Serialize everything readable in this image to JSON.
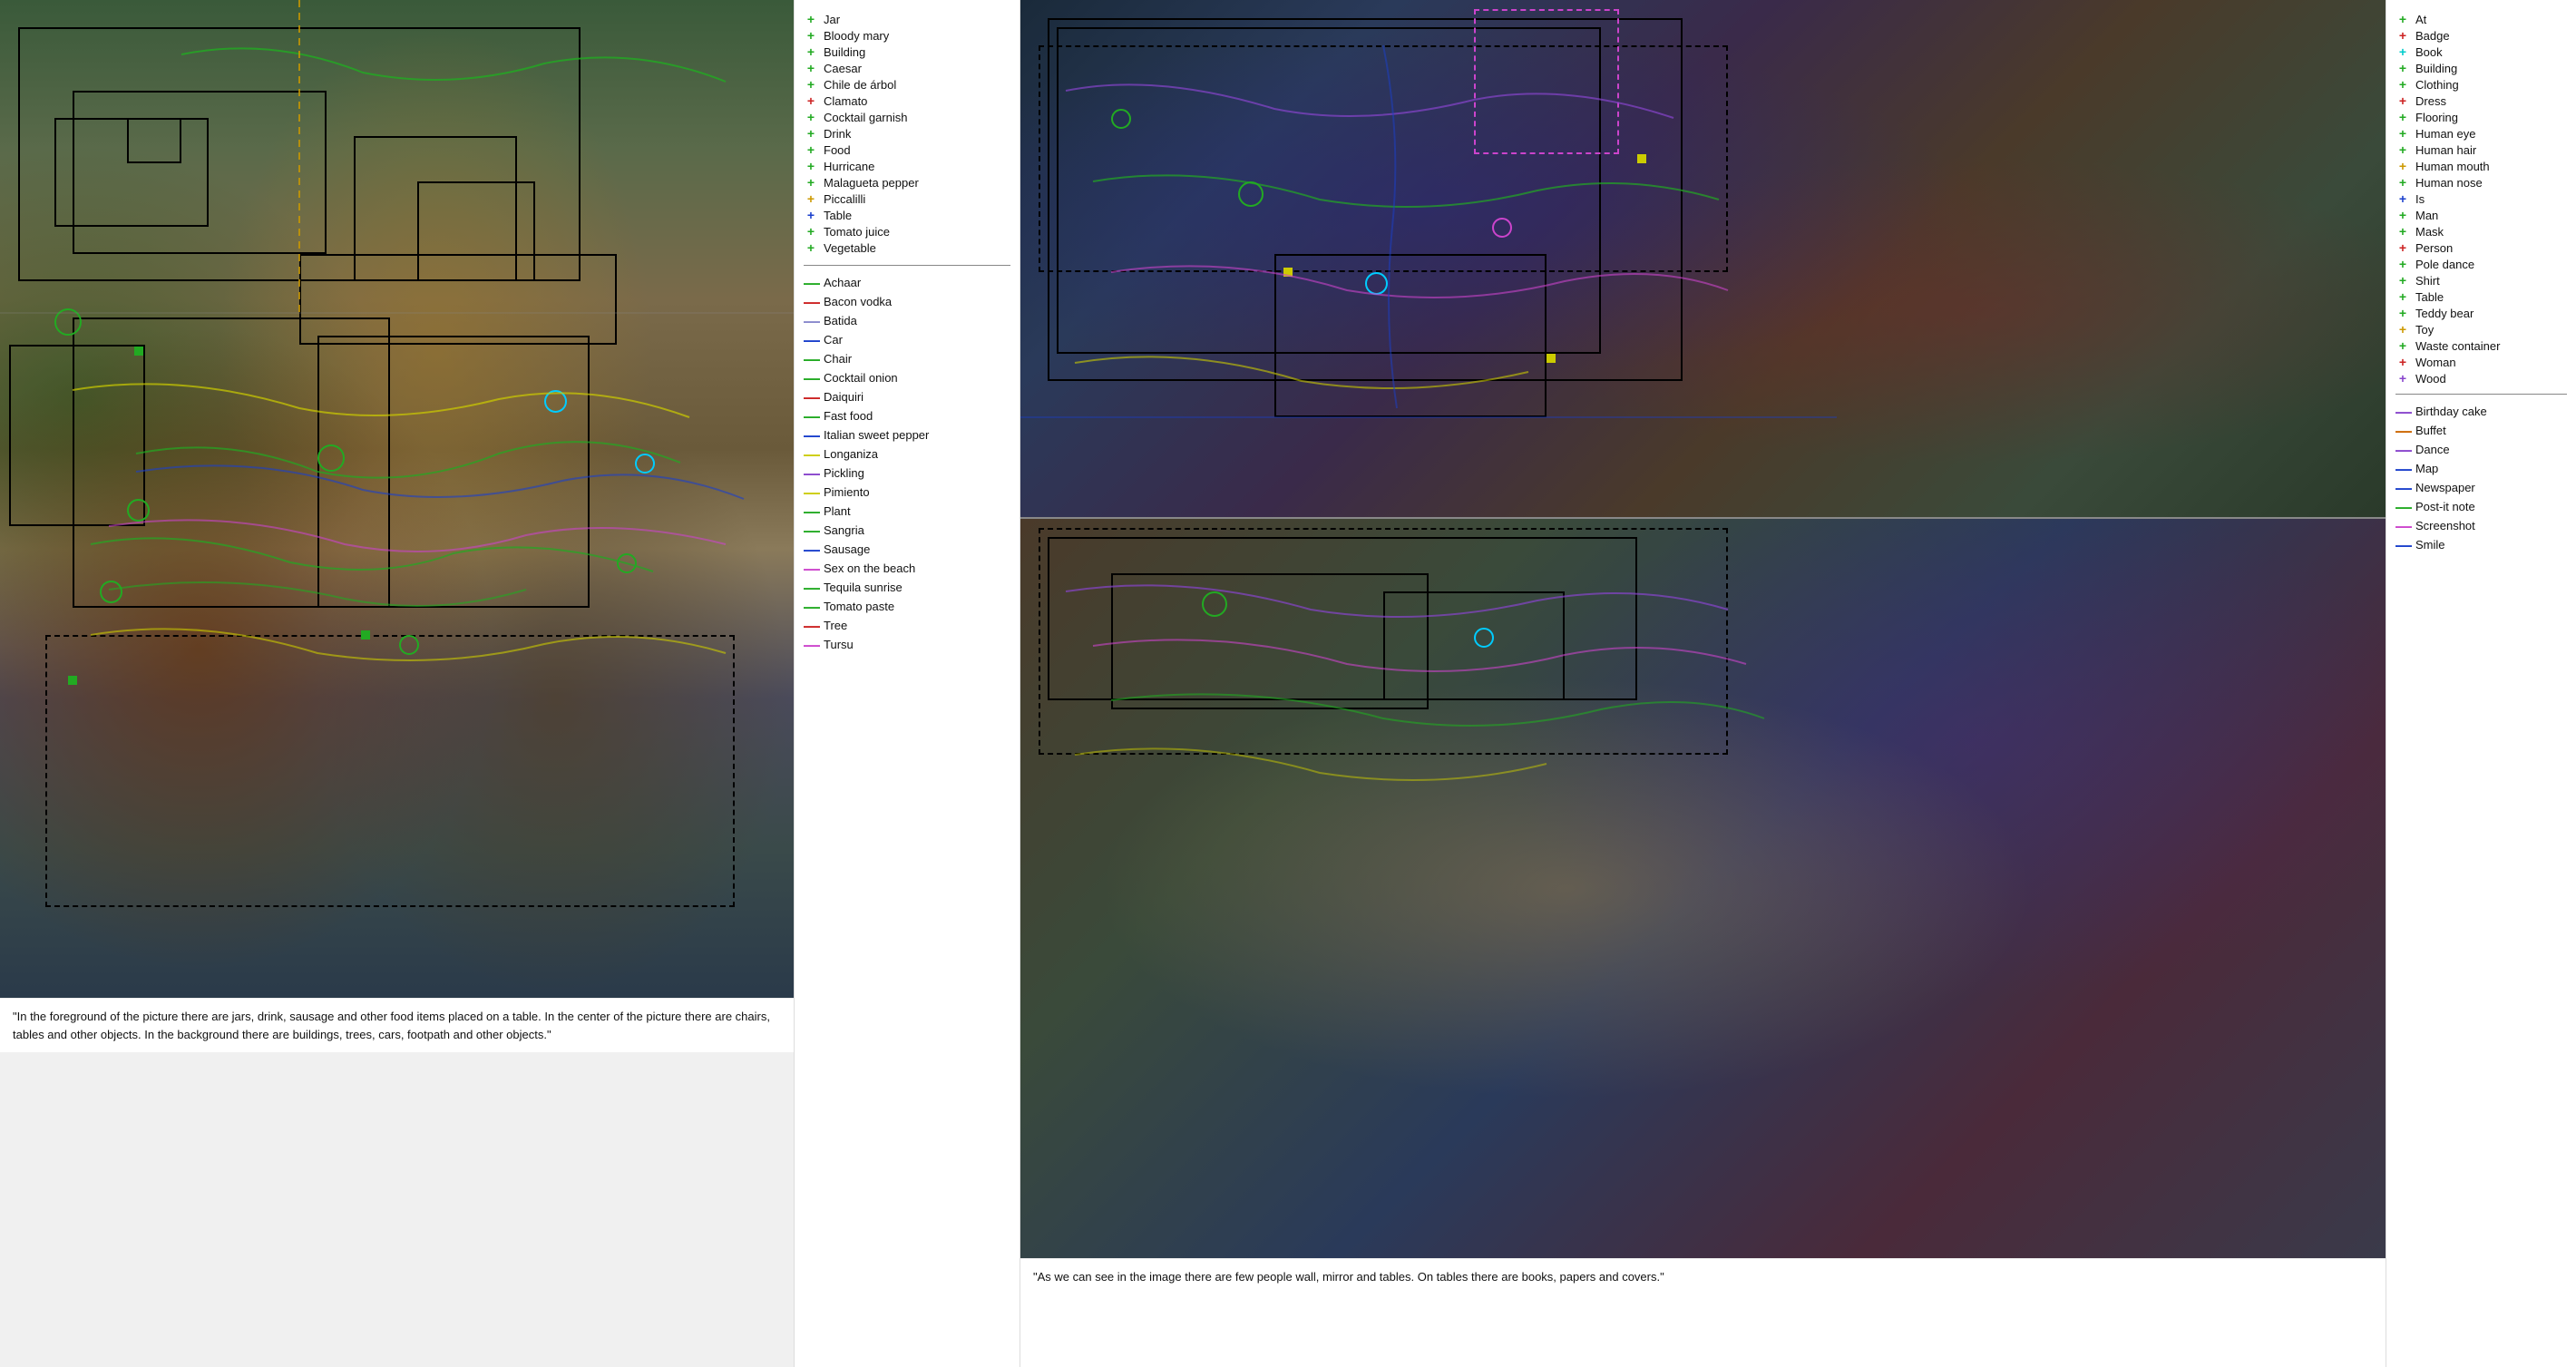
{
  "left_legend": {
    "section1": [
      {
        "icon": "+",
        "color": "#22aa22",
        "label": "Jar"
      },
      {
        "icon": "+",
        "color": "#22aa22",
        "label": "Bloody mary"
      },
      {
        "icon": "+",
        "color": "#22aa22",
        "label": "Building"
      },
      {
        "icon": "+",
        "color": "#22aa22",
        "label": "Caesar"
      },
      {
        "icon": "+",
        "color": "#22aa22",
        "label": "Chile de árbol"
      },
      {
        "icon": "+",
        "color": "#cc2222",
        "label": "Clamato"
      },
      {
        "icon": "+",
        "color": "#22aa22",
        "label": "Cocktail garnish"
      },
      {
        "icon": "+",
        "color": "#22aa22",
        "label": "Drink"
      },
      {
        "icon": "+",
        "color": "#22aa22",
        "label": "Food"
      },
      {
        "icon": "+",
        "color": "#22aa22",
        "label": "Hurricane"
      },
      {
        "icon": "+",
        "color": "#22aa22",
        "label": "Malagueta pepper"
      },
      {
        "icon": "+",
        "color": "#cc9900",
        "label": "Piccalilli"
      },
      {
        "icon": "+",
        "color": "#1a3fcc",
        "label": "Table"
      },
      {
        "icon": "+",
        "color": "#22aa22",
        "label": "Tomato juice"
      },
      {
        "icon": "+",
        "color": "#22aa22",
        "label": "Vegetable"
      }
    ],
    "section2": [
      {
        "icon": "—",
        "color": "#22aa22",
        "label": "Achaar"
      },
      {
        "icon": "—",
        "color": "#cc2222",
        "label": "Bacon vodka"
      },
      {
        "icon": "—",
        "color": "#8888cc",
        "label": "Batida"
      },
      {
        "icon": "—",
        "color": "#1a3fcc",
        "label": "Car"
      },
      {
        "icon": "—",
        "color": "#22aa22",
        "label": "Chair"
      },
      {
        "icon": "—",
        "color": "#22aa22",
        "label": "Cocktail onion"
      },
      {
        "icon": "—",
        "color": "#cc2222",
        "label": "Daiquiri"
      },
      {
        "icon": "—",
        "color": "#22aa22",
        "label": "Fast food"
      },
      {
        "icon": "—",
        "color": "#1a3fcc",
        "label": "Italian sweet pepper"
      },
      {
        "icon": "—",
        "color": "#cccc00",
        "label": "Longaniza"
      },
      {
        "icon": "—",
        "color": "#8844cc",
        "label": "Pickling"
      },
      {
        "icon": "—",
        "color": "#cccc00",
        "label": "Pimiento"
      },
      {
        "icon": "—",
        "color": "#22aa22",
        "label": "Plant"
      },
      {
        "icon": "—",
        "color": "#22aa22",
        "label": "Sangria"
      },
      {
        "icon": "—",
        "color": "#1a3fcc",
        "label": "Sausage"
      },
      {
        "icon": "—",
        "color": "#cc44cc",
        "label": "Sex on the beach"
      },
      {
        "icon": "—",
        "color": "#22aa22",
        "label": "Tequila sunrise"
      },
      {
        "icon": "—",
        "color": "#22aa22",
        "label": "Tomato paste"
      },
      {
        "icon": "—",
        "color": "#cc2222",
        "label": "Tree"
      },
      {
        "icon": "—",
        "color": "#cc44cc",
        "label": "Tursu"
      }
    ]
  },
  "right_legend": {
    "section1": [
      {
        "icon": "+",
        "color": "#22aa22",
        "label": "At"
      },
      {
        "icon": "+",
        "color": "#cc2222",
        "label": "Badge"
      },
      {
        "icon": "+",
        "color": "#00cccc",
        "label": "Book"
      },
      {
        "icon": "+",
        "color": "#22aa22",
        "label": "Building"
      },
      {
        "icon": "+",
        "color": "#22aa22",
        "label": "Clothing"
      },
      {
        "icon": "+",
        "color": "#cc2222",
        "label": "Dress"
      },
      {
        "icon": "+",
        "color": "#22aa22",
        "label": "Flooring"
      },
      {
        "icon": "+",
        "color": "#22aa22",
        "label": "Human eye"
      },
      {
        "icon": "+",
        "color": "#22aa22",
        "label": "Human hair"
      },
      {
        "icon": "+",
        "color": "#cc9900",
        "label": "Human mouth"
      },
      {
        "icon": "+",
        "color": "#22aa22",
        "label": "Human nose"
      },
      {
        "icon": "+",
        "color": "#1a3fcc",
        "label": "Is"
      },
      {
        "icon": "+",
        "color": "#22aa22",
        "label": "Man"
      },
      {
        "icon": "+",
        "color": "#22aa22",
        "label": "Mask"
      },
      {
        "icon": "+",
        "color": "#cc2222",
        "label": "Person"
      },
      {
        "icon": "+",
        "color": "#22aa22",
        "label": "Pole dance"
      },
      {
        "icon": "+",
        "color": "#22aa22",
        "label": "Shirt"
      },
      {
        "icon": "+",
        "color": "#22aa22",
        "label": "Table"
      },
      {
        "icon": "+",
        "color": "#22aa22",
        "label": "Teddy bear"
      },
      {
        "icon": "+",
        "color": "#cc9900",
        "label": "Toy"
      },
      {
        "icon": "+",
        "color": "#22aa22",
        "label": "Waste container"
      },
      {
        "icon": "+",
        "color": "#cc2222",
        "label": "Woman"
      },
      {
        "icon": "+",
        "color": "#8844cc",
        "label": "Wood"
      }
    ],
    "section2": [
      {
        "icon": "—",
        "color": "#8844cc",
        "label": "Birthday cake"
      },
      {
        "icon": "—",
        "color": "#cc6600",
        "label": "Buffet"
      },
      {
        "icon": "—",
        "color": "#8844cc",
        "label": "Dance"
      },
      {
        "icon": "—",
        "color": "#1a3fcc",
        "label": "Map"
      },
      {
        "icon": "—",
        "color": "#1a3fcc",
        "label": "Newspaper"
      },
      {
        "icon": "—",
        "color": "#22aa22",
        "label": "Post-it note"
      },
      {
        "icon": "—",
        "color": "#cc44cc",
        "label": "Screenshot"
      },
      {
        "icon": "—",
        "color": "#1a3fcc",
        "label": "Smile"
      }
    ]
  },
  "left_caption": "\"In the foreground of the picture there are jars, drink, sausage and other food items placed on a table.\nIn the center of the picture there are chairs, tables and other objects.\nIn the background there are buildings, trees, cars, footpath and other objects.\"",
  "right_caption_top": "\"As we can see in the image there are few people wall, mirror and tables.\nOn tables there are books, papers and covers.\""
}
